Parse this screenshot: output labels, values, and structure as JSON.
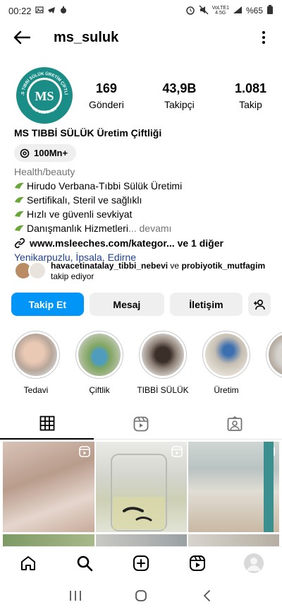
{
  "status_bar": {
    "time": "00:22",
    "network_top": "VoLTE1",
    "network_bottom": "4.5G",
    "battery": "%65"
  },
  "header": {
    "username": "ms_suluk"
  },
  "profile": {
    "avatar_text_top": "M.S TIBBİ SÜLÜK ÜRETİM ÇİFTLİĞİ",
    "avatar_text_bottom": "MS LEECHES",
    "stats": [
      {
        "value": "169",
        "label": "Gönderi"
      },
      {
        "value": "43,9B",
        "label": "Takipçi"
      },
      {
        "value": "1.081",
        "label": "Takip"
      }
    ],
    "display_name": "MS TIBBİ SÜLÜK Üretim Çiftliği",
    "threads_label": "100Mn+",
    "category": "Health/beauty",
    "bio_lines": [
      "Hirudo Verbana-Tıbbi Sülük Üretimi",
      "Sertifikalı, Steril ve sağlıklı",
      "Hızlı ve güvenli sevkiyat",
      "Danışmanlık Hizmetleri"
    ],
    "bio_more": "... devamı",
    "link": "www.msleeches.com/kategor... ve 1 diğer",
    "location": "Yenikarpuzlu, İpsala, Edirne",
    "followed_by": {
      "user1": "havacetinatalay_tibbi_nebevi",
      "connector": "ve",
      "user2": "probiyotik_mutfagim",
      "suffix": "takip ediyor"
    }
  },
  "actions": {
    "follow": "Takip Et",
    "message": "Mesaj",
    "contact": "İletişim"
  },
  "highlights": [
    {
      "label": "Tedavi"
    },
    {
      "label": "Çiftlik"
    },
    {
      "label": "TIBBİ SÜLÜK"
    },
    {
      "label": "Üretim"
    },
    {
      "label": "Ü"
    }
  ],
  "colors": {
    "accent": "#0095f6",
    "avatar_teal": "#1a8d86",
    "location": "#1d3f8f",
    "leaf_green": "#6aa63a"
  }
}
